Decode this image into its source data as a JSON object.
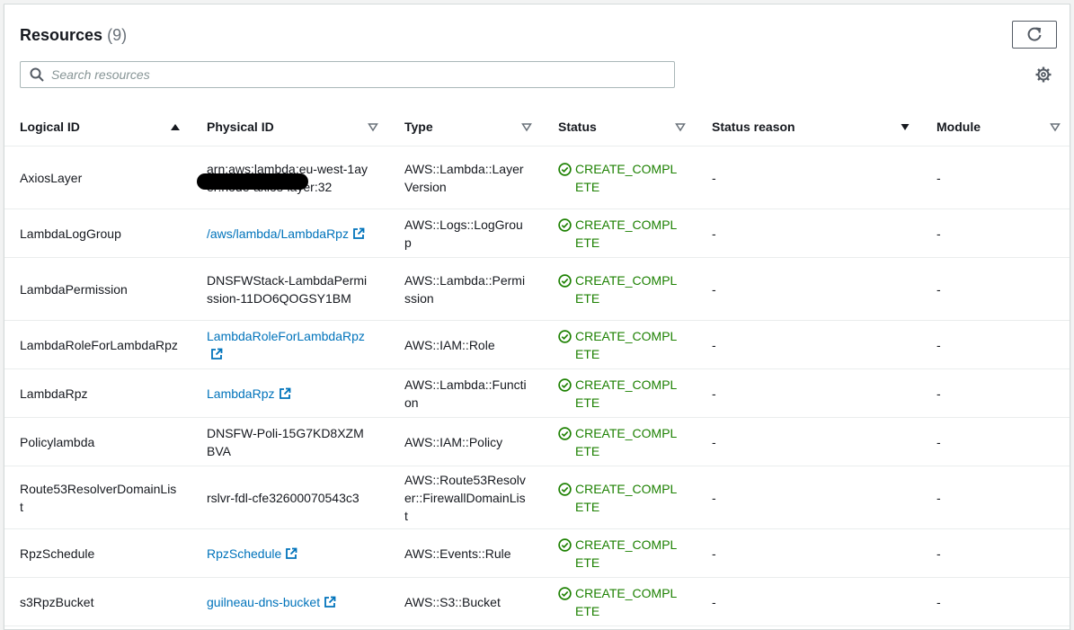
{
  "header": {
    "title": "Resources",
    "count": "(9)",
    "search_placeholder": "Search resources"
  },
  "columns": [
    "Logical ID",
    "Physical ID",
    "Type",
    "Status",
    "Status reason",
    "Module"
  ],
  "rows": [
    {
      "logical": "AxiosLayer",
      "physical": "arn:aws:lambda:eu-west-1",
      "physical_tail": "ayer:node-axios-layer:32",
      "physical_link": false,
      "type": "AWS::Lambda::LayerVersion",
      "status": "CREATE_COMPLETE",
      "reason": "-",
      "module": "-"
    },
    {
      "logical": "LambdaLogGroup",
      "physical": "/aws/lambda/LambdaRpz",
      "physical_link": true,
      "type": "AWS::Logs::LogGroup",
      "status": "CREATE_COMPLETE",
      "reason": "-",
      "module": "-"
    },
    {
      "logical": "LambdaPermission",
      "physical": "DNSFWStack-LambdaPermission-11DO6QOGSY1BM",
      "physical_link": false,
      "type": "AWS::Lambda::Permission",
      "status": "CREATE_COMPLETE",
      "reason": "-",
      "module": "-"
    },
    {
      "logical": "LambdaRoleForLambdaRpz",
      "physical": "LambdaRoleForLambdaRpz",
      "physical_link": true,
      "type": "AWS::IAM::Role",
      "status": "CREATE_COMPLETE",
      "reason": "-",
      "module": "-"
    },
    {
      "logical": "LambdaRpz",
      "physical": "LambdaRpz",
      "physical_link": true,
      "type": "AWS::Lambda::Function",
      "status": "CREATE_COMPLETE",
      "reason": "-",
      "module": "-"
    },
    {
      "logical": "Policylambda",
      "physical": "DNSFW-Poli-15G7KD8XZMBVA",
      "physical_link": false,
      "type": "AWS::IAM::Policy",
      "status": "CREATE_COMPLETE",
      "reason": "-",
      "module": "-"
    },
    {
      "logical": "Route53ResolverDomainList",
      "physical": "rslvr-fdl-cfe32600070543c3",
      "physical_link": false,
      "type": "AWS::Route53Resolver::FirewallDomainList",
      "status": "CREATE_COMPLETE",
      "reason": "-",
      "module": "-"
    },
    {
      "logical": "RpzSchedule",
      "physical": "RpzSchedule",
      "physical_link": true,
      "type": "AWS::Events::Rule",
      "status": "CREATE_COMPLETE",
      "reason": "-",
      "module": "-"
    },
    {
      "logical": "s3RpzBucket",
      "physical": "guilneau-dns-bucket",
      "physical_link": true,
      "type": "AWS::S3::Bucket",
      "status": "CREATE_COMPLETE",
      "reason": "-",
      "module": "-"
    }
  ],
  "colors": {
    "link": "#0073bb",
    "success": "#1d8102",
    "border": "#eaeded"
  },
  "icons": [
    "search-icon",
    "refresh-icon",
    "gear-icon",
    "sort-ascending-icon",
    "sort-descending-icon",
    "external-link-icon",
    "status-success-icon"
  ]
}
